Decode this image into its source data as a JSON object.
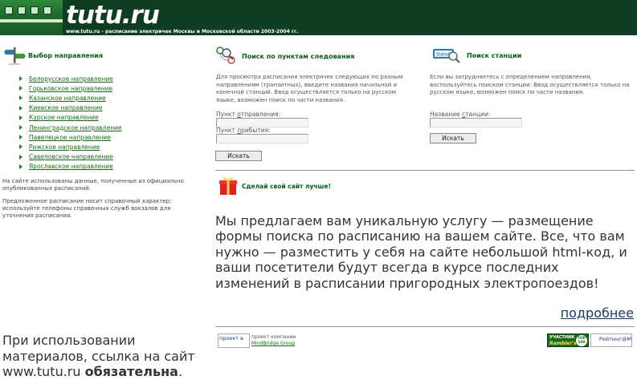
{
  "header": {
    "logo": "tutu.ru",
    "subtitle": "www.tutu.ru - расписание электричек Москвы и Московской области 2003-2004 гг."
  },
  "directions": {
    "title": "Выбор направления",
    "items": [
      "Белорусское направление",
      "Горьковское направление",
      "Казанское направление",
      "Киевское направление",
      "Курское направление",
      "Ленинградское направление",
      "Павелецкое направление",
      "Рижское направление",
      "Савеловское направление",
      "Ярославское направление"
    ]
  },
  "left_notes": {
    "note1": "На сайте использованы данные, полученные из официально опубликованных расписаний.",
    "note2": "Предложенное расписание носит справочный характер: используйте телефоны справочных служб вокзалов для уточнения расписания.",
    "citation_prefix": "При использовании материалов, ссылка на сайт www.tutu.ru ",
    "citation_bold": "обязательна",
    "citation_suffix": "."
  },
  "route_search": {
    "title": "Поиск по пунктам следования",
    "description": "Для просмотра расписания электричек следующих по разным направлениям (транзитных), введите названия начальной и конечной станций. Ввод осуществляется только на русском языке, возможен поиск по части названия.",
    "from_label_pre": "Пункт ",
    "from_label_u": "о",
    "from_label_post": "тправления:",
    "from_value": "",
    "to_label_pre": "Пункт ",
    "to_label_u": "п",
    "to_label_post": "рибытия:",
    "to_value": "",
    "button": "Искать"
  },
  "station_search": {
    "title": "Поиск станции",
    "description": "Если вы затрудняетесь с определением направления, воспользуйтесь поиском станции. Ввод осуществляется только на русском языке, возможен поиск по части названия.",
    "label_pre": "Название ",
    "label_u": "с",
    "label_post": "танции:",
    "value": "",
    "button": "Искать"
  },
  "promo": {
    "title": "Сделай свой сайт лучше!",
    "text": "Мы предлагаем вам уникальную услугу — размещение формы поиска по расписанию на вашем сайте. Все, что вам нужно — разместить у себя на сайте небольшой html-код, и ваши посетители будут всегда в курсе последних изменений в расписании пригородных электропоездов!",
    "more_link": "подробнее"
  },
  "footer": {
    "partner_img_alt": "проект в",
    "partner_text": "проект компании",
    "partner_link": "MindBridge Group",
    "rambler_line1": "УЧАСТНИК",
    "rambler_line2": "Rambler's",
    "rambler_top": "TOP 100",
    "rating_alt": "Рейтинг@Ма"
  },
  "colors": {
    "header_bg": "#0f3d22",
    "link_green": "#1a6a1a",
    "title_green": "#0a5a1c"
  }
}
